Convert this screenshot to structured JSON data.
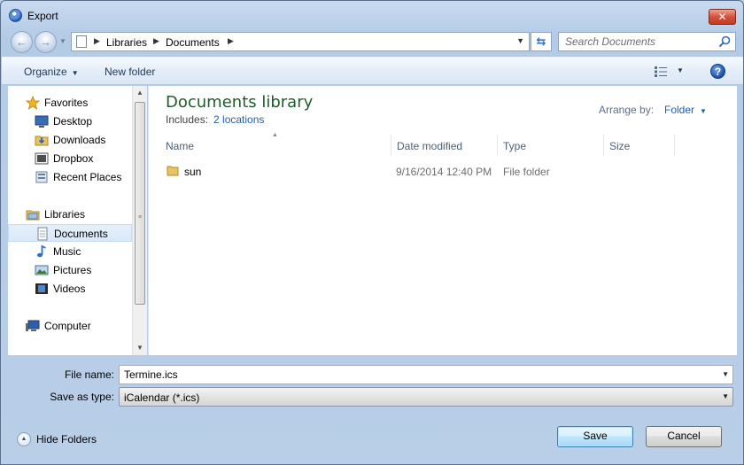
{
  "window": {
    "title": "Export",
    "close_glyph": "✕"
  },
  "address": {
    "back_glyph": "←",
    "forward_glyph": "→",
    "breadcrumbs": [
      "Libraries",
      "Documents"
    ],
    "search_placeholder": "Search Documents"
  },
  "toolbar": {
    "organize_label": "Organize",
    "new_folder_label": "New folder",
    "help_glyph": "?"
  },
  "nav": {
    "favorites": {
      "label": "Favorites",
      "items": [
        "Desktop",
        "Downloads",
        "Dropbox",
        "Recent Places"
      ]
    },
    "libraries": {
      "label": "Libraries",
      "items": [
        "Documents",
        "Music",
        "Pictures",
        "Videos"
      ]
    },
    "computer": {
      "label": "Computer"
    },
    "selected": "Documents"
  },
  "content": {
    "library_title": "Documents library",
    "includes_label": "Includes:",
    "includes_link": "2 locations",
    "arrange_label": "Arrange by:",
    "arrange_value": "Folder",
    "columns": [
      "Name",
      "Date modified",
      "Type",
      "Size"
    ],
    "rows": [
      {
        "name": "sun",
        "date_modified": "9/16/2014 12:40 PM",
        "type": "File folder",
        "size": ""
      }
    ]
  },
  "form": {
    "file_name_label": "File name:",
    "file_name_value": "Termine.ics",
    "save_type_label": "Save as type:",
    "save_type_value": "iCalendar (*.ics)"
  },
  "footer": {
    "hide_folders_label": "Hide Folders",
    "save_label": "Save",
    "cancel_label": "Cancel"
  },
  "colors": {
    "library_title": "#1e5d2b",
    "link": "#1f5fb0",
    "close_button": "#c13a22"
  }
}
